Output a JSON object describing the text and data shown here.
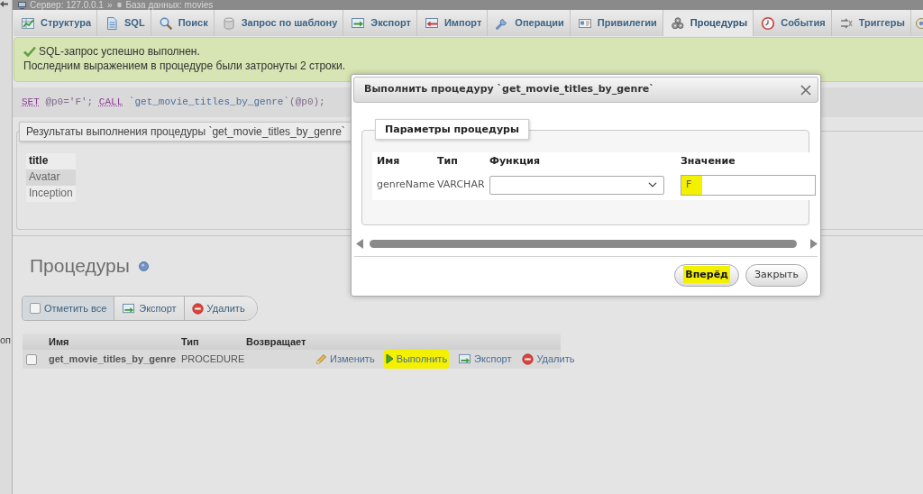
{
  "breadcrumb": {
    "server": "Сервер: 127.0.0.1",
    "separator": "»",
    "database": "База данных: movies"
  },
  "navigation_panel": {
    "text_fragment": "оп"
  },
  "tabs": [
    {
      "label": "Структура",
      "selected": false
    },
    {
      "label": "SQL",
      "selected": false
    },
    {
      "label": "Поиск",
      "selected": false
    },
    {
      "label": "Запрос по шаблону",
      "selected": false
    },
    {
      "label": "Экспорт",
      "selected": false
    },
    {
      "label": "Импорт",
      "selected": false
    },
    {
      "label": "Операции",
      "selected": false
    },
    {
      "label": "Привилегии",
      "selected": false
    },
    {
      "label": "Процедуры",
      "selected": true
    },
    {
      "label": "События",
      "selected": false
    },
    {
      "label": "Триггеры",
      "selected": false
    }
  ],
  "message": {
    "kind": "success",
    "title": "SQL-запрос успешно выполнен.",
    "text": "Последним выражением в процедуре были затронуты 2 строки."
  },
  "sql_query": [
    {
      "kind": "keyword",
      "text": "SET"
    },
    {
      "kind": "plain",
      "text": " @p0='F'; "
    },
    {
      "kind": "keyword",
      "text": "CALL"
    },
    {
      "kind": "identifier",
      "text": " `get_movie_titles_by_genre`"
    },
    {
      "kind": "plain",
      "text": "(@p0);"
    }
  ],
  "results": {
    "legend": "Результаты выполнения процедуры `get_movie_titles_by_genre`",
    "columns": [
      "title"
    ],
    "rows": [
      [
        "Avatar"
      ],
      [
        "Inception"
      ]
    ]
  },
  "procedures": {
    "heading": "Процедуры",
    "toolbar": [
      {
        "kind": "check_all",
        "label": "Отметить все",
        "checked": false
      },
      {
        "kind": "export",
        "label": "Экспорт"
      },
      {
        "kind": "delete",
        "label": "Удалить"
      }
    ],
    "columns": [
      "Имя",
      "Тип",
      "Возвращает"
    ],
    "rows": [
      {
        "checked": false,
        "name": "get_movie_titles_by_genre",
        "type": "PROCEDURE",
        "actions": [
          {
            "kind": "edit",
            "label": "Изменить",
            "highlighted": false
          },
          {
            "kind": "execute",
            "label": "Выполнить",
            "highlighted": true
          },
          {
            "kind": "export",
            "label": "Экспорт",
            "highlighted": false
          },
          {
            "kind": "delete",
            "label": "Удалить",
            "highlighted": false
          }
        ]
      }
    ]
  },
  "dialog": {
    "title": "Выполнить процедуру `get_movie_titles_by_genre`",
    "legend": "Параметры процедуры",
    "columns": [
      "Имя",
      "Тип",
      "Функция",
      "Значение"
    ],
    "params": [
      {
        "name": "genreName",
        "type": "VARCHAR",
        "value": "F",
        "value_highlighted": true
      }
    ],
    "buttons": [
      {
        "kind": "primary",
        "label": "Вперёд",
        "highlighted": true
      },
      {
        "kind": "secondary",
        "label": "Закрыть",
        "highlighted": false
      }
    ]
  }
}
